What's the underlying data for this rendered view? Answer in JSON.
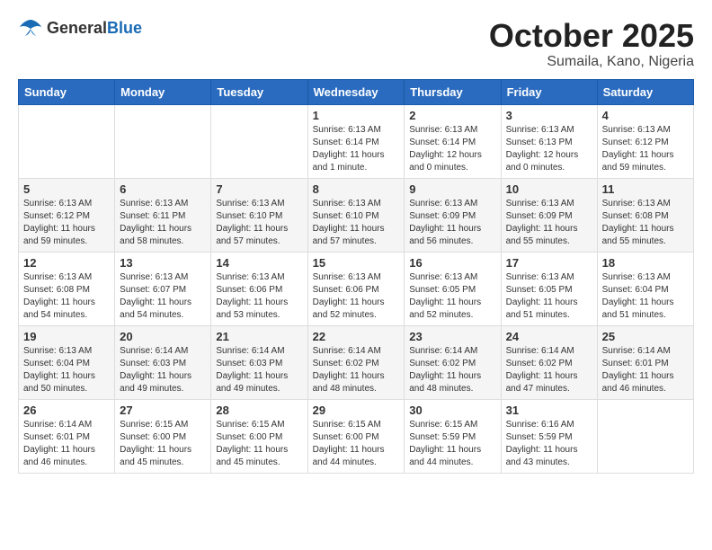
{
  "header": {
    "logo": {
      "general": "General",
      "blue": "Blue"
    },
    "month": "October 2025",
    "location": "Sumaila, Kano, Nigeria"
  },
  "weekdays": [
    "Sunday",
    "Monday",
    "Tuesday",
    "Wednesday",
    "Thursday",
    "Friday",
    "Saturday"
  ],
  "weeks": [
    [
      {
        "day": "",
        "info": ""
      },
      {
        "day": "",
        "info": ""
      },
      {
        "day": "",
        "info": ""
      },
      {
        "day": "1",
        "info": "Sunrise: 6:13 AM\nSunset: 6:14 PM\nDaylight: 11 hours\nand 1 minute."
      },
      {
        "day": "2",
        "info": "Sunrise: 6:13 AM\nSunset: 6:14 PM\nDaylight: 12 hours\nand 0 minutes."
      },
      {
        "day": "3",
        "info": "Sunrise: 6:13 AM\nSunset: 6:13 PM\nDaylight: 12 hours\nand 0 minutes."
      },
      {
        "day": "4",
        "info": "Sunrise: 6:13 AM\nSunset: 6:12 PM\nDaylight: 11 hours\nand 59 minutes."
      }
    ],
    [
      {
        "day": "5",
        "info": "Sunrise: 6:13 AM\nSunset: 6:12 PM\nDaylight: 11 hours\nand 59 minutes."
      },
      {
        "day": "6",
        "info": "Sunrise: 6:13 AM\nSunset: 6:11 PM\nDaylight: 11 hours\nand 58 minutes."
      },
      {
        "day": "7",
        "info": "Sunrise: 6:13 AM\nSunset: 6:10 PM\nDaylight: 11 hours\nand 57 minutes."
      },
      {
        "day": "8",
        "info": "Sunrise: 6:13 AM\nSunset: 6:10 PM\nDaylight: 11 hours\nand 57 minutes."
      },
      {
        "day": "9",
        "info": "Sunrise: 6:13 AM\nSunset: 6:09 PM\nDaylight: 11 hours\nand 56 minutes."
      },
      {
        "day": "10",
        "info": "Sunrise: 6:13 AM\nSunset: 6:09 PM\nDaylight: 11 hours\nand 55 minutes."
      },
      {
        "day": "11",
        "info": "Sunrise: 6:13 AM\nSunset: 6:08 PM\nDaylight: 11 hours\nand 55 minutes."
      }
    ],
    [
      {
        "day": "12",
        "info": "Sunrise: 6:13 AM\nSunset: 6:08 PM\nDaylight: 11 hours\nand 54 minutes."
      },
      {
        "day": "13",
        "info": "Sunrise: 6:13 AM\nSunset: 6:07 PM\nDaylight: 11 hours\nand 54 minutes."
      },
      {
        "day": "14",
        "info": "Sunrise: 6:13 AM\nSunset: 6:06 PM\nDaylight: 11 hours\nand 53 minutes."
      },
      {
        "day": "15",
        "info": "Sunrise: 6:13 AM\nSunset: 6:06 PM\nDaylight: 11 hours\nand 52 minutes."
      },
      {
        "day": "16",
        "info": "Sunrise: 6:13 AM\nSunset: 6:05 PM\nDaylight: 11 hours\nand 52 minutes."
      },
      {
        "day": "17",
        "info": "Sunrise: 6:13 AM\nSunset: 6:05 PM\nDaylight: 11 hours\nand 51 minutes."
      },
      {
        "day": "18",
        "info": "Sunrise: 6:13 AM\nSunset: 6:04 PM\nDaylight: 11 hours\nand 51 minutes."
      }
    ],
    [
      {
        "day": "19",
        "info": "Sunrise: 6:13 AM\nSunset: 6:04 PM\nDaylight: 11 hours\nand 50 minutes."
      },
      {
        "day": "20",
        "info": "Sunrise: 6:14 AM\nSunset: 6:03 PM\nDaylight: 11 hours\nand 49 minutes."
      },
      {
        "day": "21",
        "info": "Sunrise: 6:14 AM\nSunset: 6:03 PM\nDaylight: 11 hours\nand 49 minutes."
      },
      {
        "day": "22",
        "info": "Sunrise: 6:14 AM\nSunset: 6:02 PM\nDaylight: 11 hours\nand 48 minutes."
      },
      {
        "day": "23",
        "info": "Sunrise: 6:14 AM\nSunset: 6:02 PM\nDaylight: 11 hours\nand 48 minutes."
      },
      {
        "day": "24",
        "info": "Sunrise: 6:14 AM\nSunset: 6:02 PM\nDaylight: 11 hours\nand 47 minutes."
      },
      {
        "day": "25",
        "info": "Sunrise: 6:14 AM\nSunset: 6:01 PM\nDaylight: 11 hours\nand 46 minutes."
      }
    ],
    [
      {
        "day": "26",
        "info": "Sunrise: 6:14 AM\nSunset: 6:01 PM\nDaylight: 11 hours\nand 46 minutes."
      },
      {
        "day": "27",
        "info": "Sunrise: 6:15 AM\nSunset: 6:00 PM\nDaylight: 11 hours\nand 45 minutes."
      },
      {
        "day": "28",
        "info": "Sunrise: 6:15 AM\nSunset: 6:00 PM\nDaylight: 11 hours\nand 45 minutes."
      },
      {
        "day": "29",
        "info": "Sunrise: 6:15 AM\nSunset: 6:00 PM\nDaylight: 11 hours\nand 44 minutes."
      },
      {
        "day": "30",
        "info": "Sunrise: 6:15 AM\nSunset: 5:59 PM\nDaylight: 11 hours\nand 44 minutes."
      },
      {
        "day": "31",
        "info": "Sunrise: 6:16 AM\nSunset: 5:59 PM\nDaylight: 11 hours\nand 43 minutes."
      },
      {
        "day": "",
        "info": ""
      }
    ]
  ]
}
